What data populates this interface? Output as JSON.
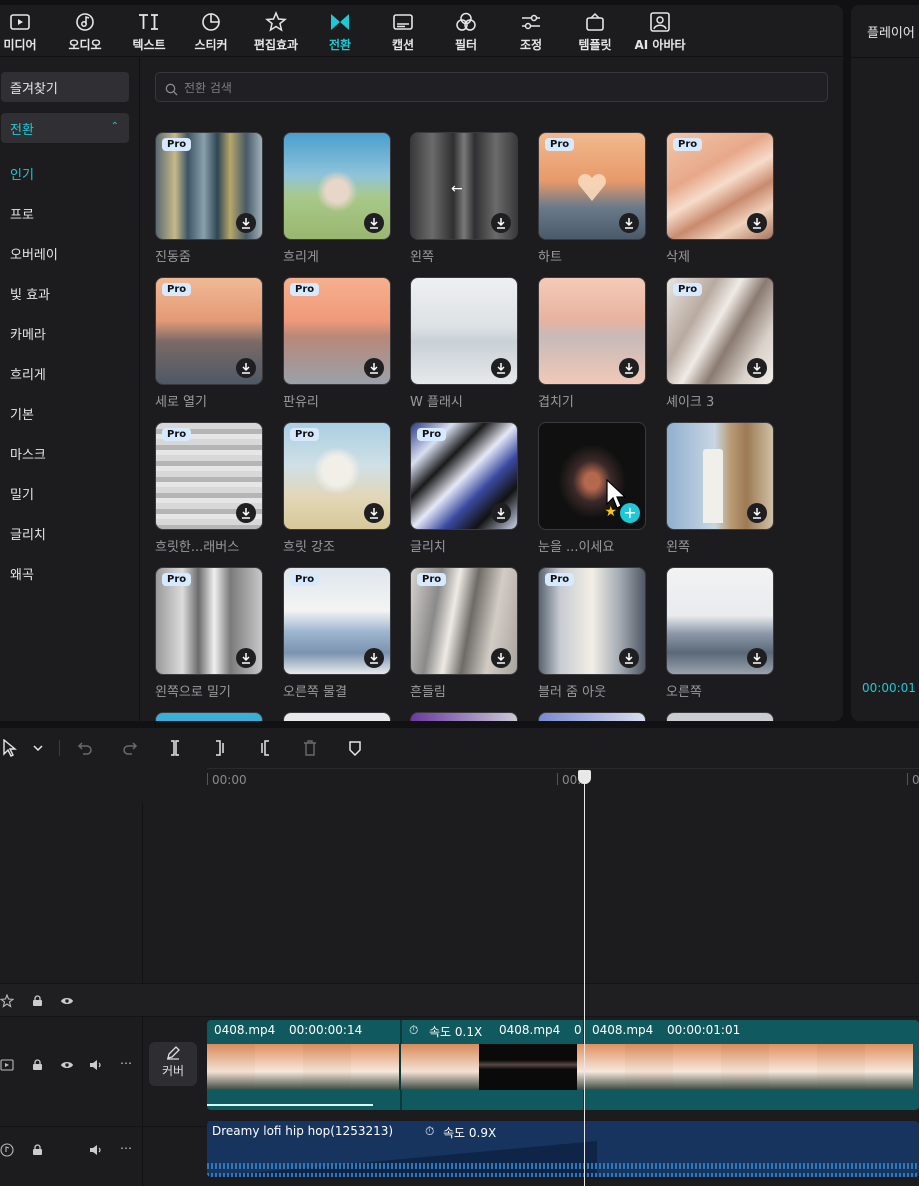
{
  "toolbar": {
    "tabs": [
      {
        "label": "미디어",
        "icon": "media-icon"
      },
      {
        "label": "오디오",
        "icon": "audio-icon"
      },
      {
        "label": "텍스트",
        "icon": "text-icon"
      },
      {
        "label": "스티커",
        "icon": "sticker-icon"
      },
      {
        "label": "편집효과",
        "icon": "effects-icon"
      },
      {
        "label": "전환",
        "icon": "transition-icon",
        "active": true
      },
      {
        "label": "캡션",
        "icon": "caption-icon"
      },
      {
        "label": "필터",
        "icon": "filter-icon"
      },
      {
        "label": "조정",
        "icon": "adjust-icon"
      },
      {
        "label": "템플릿",
        "icon": "template-icon"
      },
      {
        "label": "AI 아바타",
        "icon": "ai-avatar-icon"
      }
    ]
  },
  "sidebar": {
    "favorites": "즐겨찾기",
    "category": "전환",
    "items": [
      "인기",
      "프로",
      "오버레이",
      "빛 효과",
      "카메라",
      "흐리게",
      "기본",
      "마스크",
      "밀기",
      "글리치",
      "왜곡"
    ]
  },
  "search": {
    "placeholder": "전환 검색"
  },
  "grid": {
    "pro_label": "Pro",
    "items": [
      {
        "name": "진동줌",
        "pro": true
      },
      {
        "name": "흐리게",
        "pro": false
      },
      {
        "name": "왼쪽",
        "pro": false
      },
      {
        "name": "하트",
        "pro": true
      },
      {
        "name": "삭제",
        "pro": true
      },
      {
        "name": "세로 열기",
        "pro": true
      },
      {
        "name": "판유리",
        "pro": true
      },
      {
        "name": "W 플래시",
        "pro": false
      },
      {
        "name": "겹치기",
        "pro": false
      },
      {
        "name": "셰이크 3",
        "pro": true
      },
      {
        "name": "흐릿한...래버스",
        "pro": true
      },
      {
        "name": "흐릿 강조",
        "pro": true
      },
      {
        "name": "글리치",
        "pro": true
      },
      {
        "name": "눈을 ...이세요",
        "pro": false,
        "hovered": true
      },
      {
        "name": "왼쪽",
        "pro": false
      },
      {
        "name": "왼쪽으로 밀기",
        "pro": true
      },
      {
        "name": "오른쪽 물결",
        "pro": true
      },
      {
        "name": "흔들림",
        "pro": true
      },
      {
        "name": "블러 줌 아웃",
        "pro": true
      },
      {
        "name": "오른쪽",
        "pro": false
      }
    ]
  },
  "player": {
    "title": "플레이어",
    "time": "00:00:01"
  },
  "timeline": {
    "ruler": {
      "t0": "00:00",
      "t1": "00:0",
      "t2": "0"
    },
    "cover_label": "커버",
    "clips": [
      {
        "name": "0408.mp4",
        "duration": "00:00:00:14"
      },
      {
        "speed": "속도 0.1X",
        "name": "0408.mp4",
        "extra": "0"
      },
      {
        "name": "0408.mp4",
        "duration": "00:00:01:01"
      }
    ],
    "audio": {
      "name": "Dreamy lofi hip hop(1253213)",
      "speed": "속도 0.9X"
    }
  }
}
